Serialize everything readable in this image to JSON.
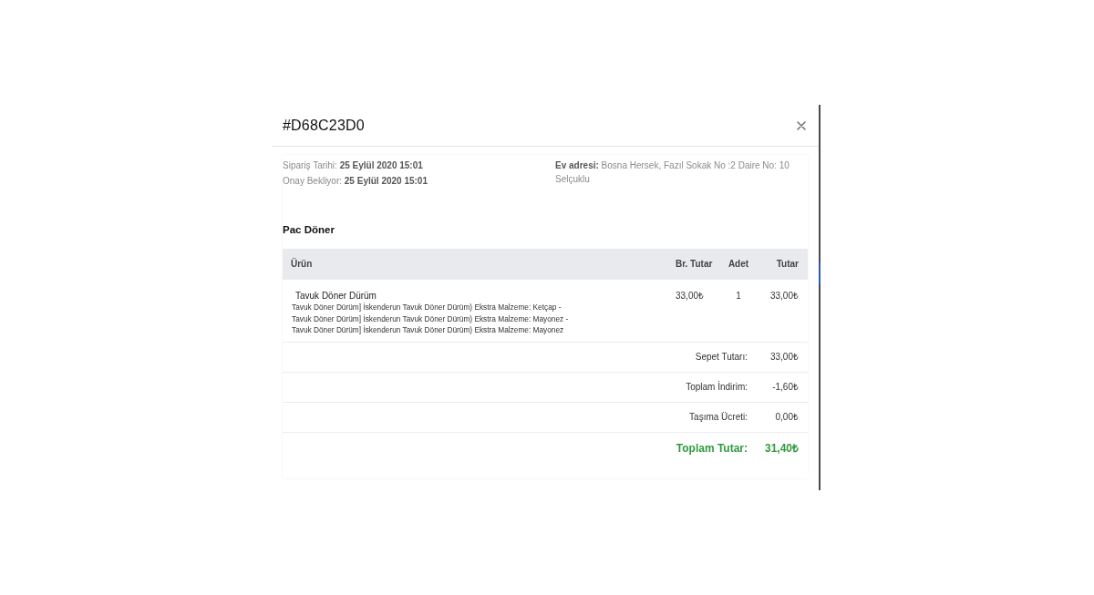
{
  "modal": {
    "title": "#D68C23D0",
    "order_info": [
      {
        "label": "Sipariş Tarihi:",
        "value": "25 Eylül 2020 15:01"
      },
      {
        "label": "Onay Bekliyor:",
        "value": "25 Eylül 2020 15:01"
      }
    ],
    "address": {
      "label": "Ev adresi:",
      "value": "Bosna Hersek, Fazıl Sokak No :2 Daire No: 10 Selçuklu"
    },
    "restaurant": "Pac Döner",
    "table": {
      "columns": [
        "Ürün",
        "Br. Tutar",
        "Adet",
        "Tutar"
      ],
      "rows": [
        {
          "name": "Tavuk Döner Dürüm",
          "details": [
            "Tavuk Döner Dürüm] İskenderun Tavuk Döner Dürüm) Ekstra Malzeme: Ketçap -",
            "Tavuk Döner Dürüm] İskenderun Tavuk Döner Dürüm) Ekstra Malzeme: Mayonez -",
            "Tavuk Döner Dürüm] İskenderun Tavuk Döner Dürüm) Ekstra Malzeme: Mayonez"
          ],
          "unit_price": "33,00₺",
          "quantity": "1",
          "total": "33,00₺"
        }
      ]
    },
    "summary": [
      {
        "kind": "line",
        "label": "Sepet Tutarı:",
        "value": "33,00₺"
      },
      {
        "kind": "line",
        "label": "Toplam İndirim:",
        "value": "-1,60₺"
      },
      {
        "kind": "line",
        "label": "Taşıma Ücreti:",
        "value": "0,00₺"
      },
      {
        "kind": "total",
        "label": "Toplam Tutar:",
        "value": "31,40₺"
      }
    ]
  }
}
